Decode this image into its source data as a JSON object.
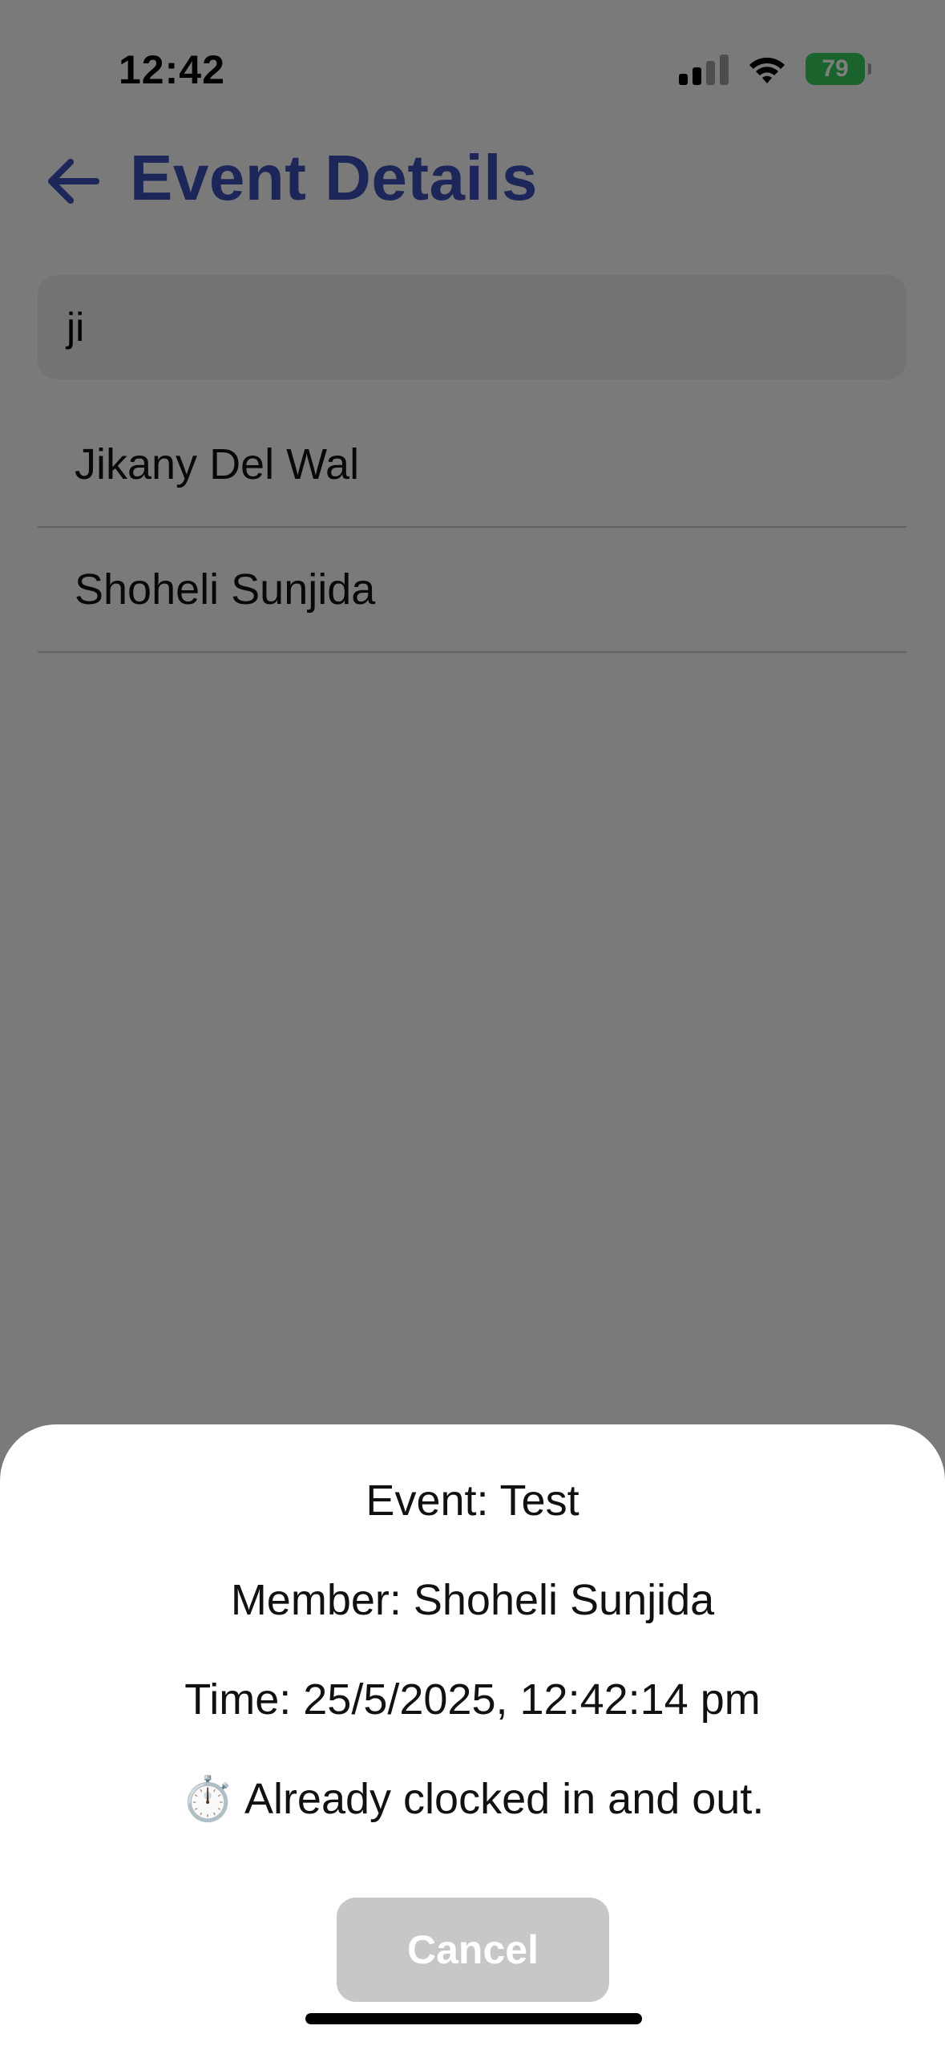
{
  "status_bar": {
    "time": "12:42",
    "battery_level": "79",
    "battery_color": "#34c759",
    "icons": [
      "cellular-signal-icon",
      "wifi-icon",
      "battery-charging-icon"
    ]
  },
  "header": {
    "title": "Event Details",
    "back_icon": "arrow-left-icon",
    "accent_color": "#3a4db2"
  },
  "search": {
    "value": "ji"
  },
  "results": [
    {
      "name": "Jikany Del Wal"
    },
    {
      "name": "Shoheli Sunjida"
    }
  ],
  "dialog": {
    "event_line": "Event: Test",
    "member_line": "Member: Shoheli Sunjida",
    "time_line": "Time: 25/5/2025, 12:42:14 pm",
    "status_icon": "⏱️",
    "status_text": "Already clocked in and out.",
    "cancel_label": "Cancel"
  }
}
